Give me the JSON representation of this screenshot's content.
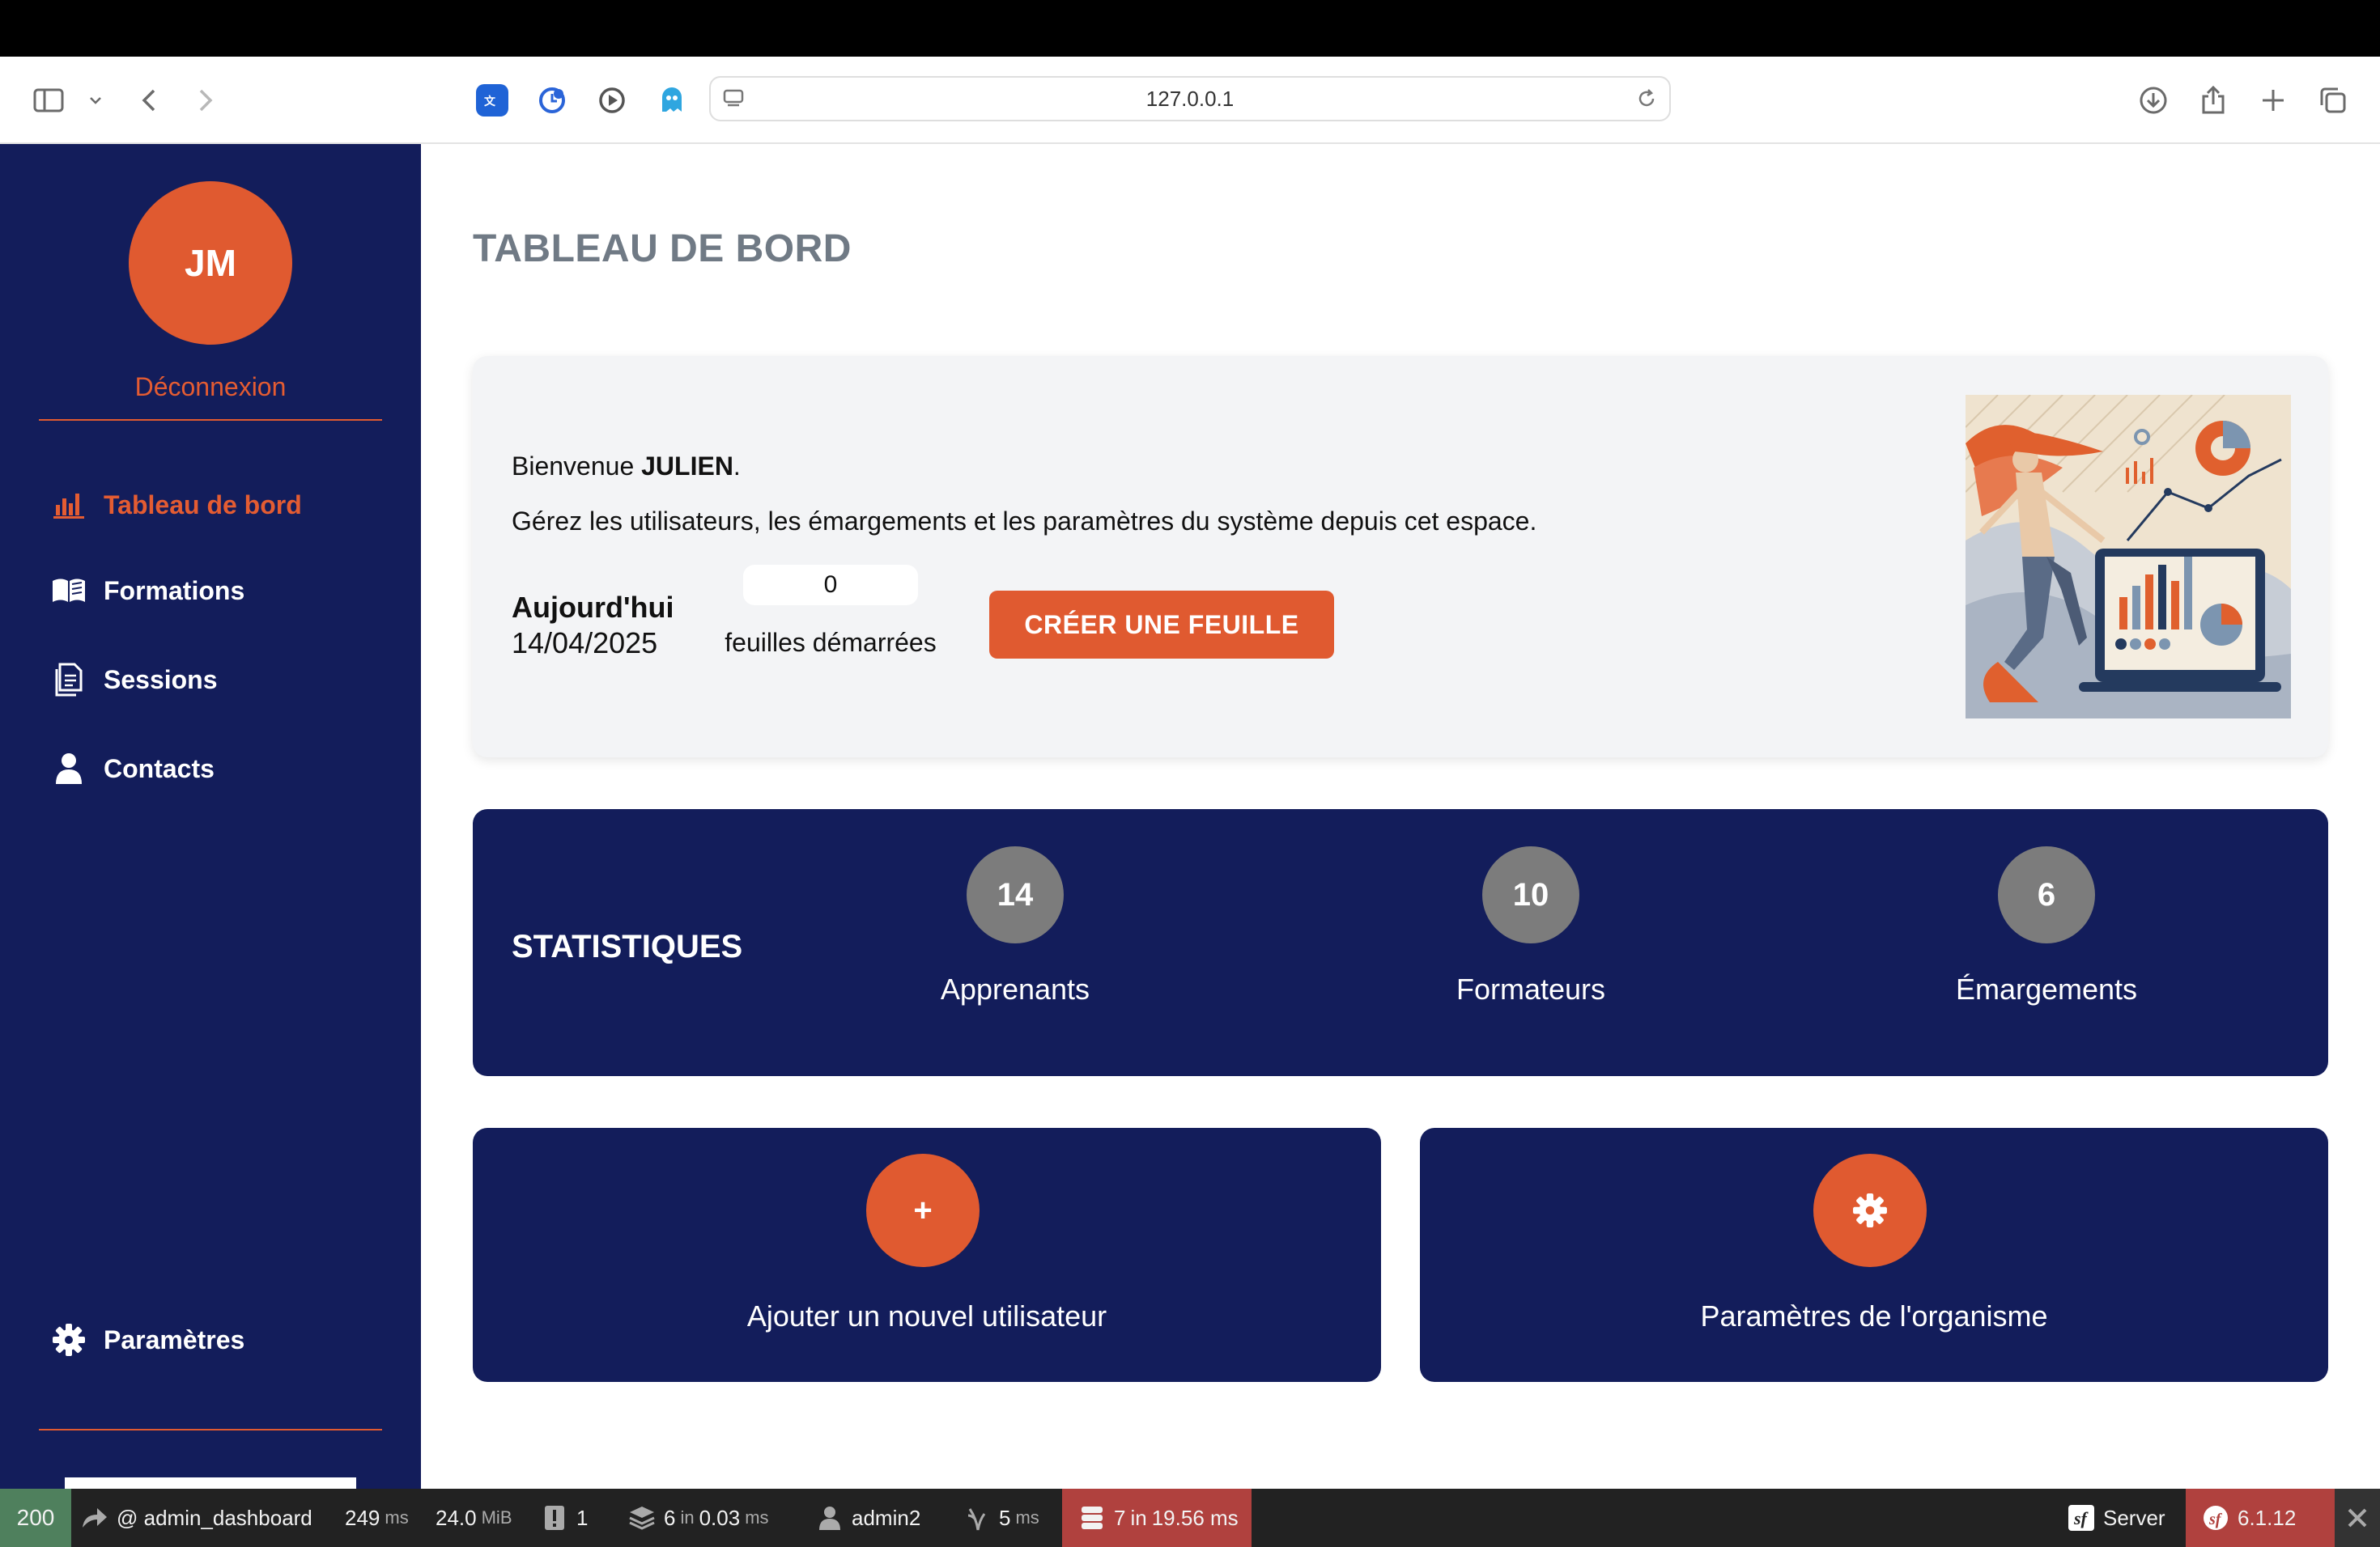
{
  "browser": {
    "url": "127.0.0.1"
  },
  "sidebar": {
    "avatar_initials": "JM",
    "logout_label": "Déconnexion",
    "items": [
      {
        "label": "Tableau de bord",
        "icon": "bar-chart-icon",
        "active": true
      },
      {
        "label": "Formations",
        "icon": "book-open-icon",
        "active": false
      },
      {
        "label": "Sessions",
        "icon": "documents-icon",
        "active": false
      },
      {
        "label": "Contacts",
        "icon": "user-icon",
        "active": false
      }
    ],
    "settings_label": "Paramètres"
  },
  "main": {
    "page_title": "TABLEAU DE BORD",
    "welcome": {
      "greeting_prefix": "Bienvenue ",
      "user_name": "JULIEN",
      "greeting_suffix": ".",
      "description": "Gérez les utilisateurs, les émargements et les paramètres du système depuis cet espace.",
      "today_label": "Aujourd'hui",
      "today_date": "14/04/2025",
      "sheets_count": "0",
      "sheets_label": "feuilles démarrées",
      "create_button": "CRÉER UNE FEUILLE"
    },
    "stats": {
      "title": "STATISTIQUES",
      "items": [
        {
          "value": "14",
          "label": "Apprenants"
        },
        {
          "value": "10",
          "label": "Formateurs"
        },
        {
          "value": "6",
          "label": "Émargements"
        }
      ]
    },
    "cards": [
      {
        "icon_glyph": "+",
        "icon": "plus-icon",
        "label": "Ajouter un nouvel utilisateur"
      },
      {
        "icon": "gear-icon",
        "label": "Paramètres de l'organisme"
      }
    ]
  },
  "debug_toolbar": {
    "status_code": "200",
    "route": "@ admin_dashboard",
    "time_value": "249",
    "time_unit": "ms",
    "memory_value": "24.0",
    "memory_unit": "MiB",
    "logs_count": "1",
    "cache_count": "6",
    "cache_in": "in",
    "cache_time": "0.03",
    "cache_unit": "ms",
    "user": "admin2",
    "twig_time": "5",
    "twig_unit": "ms",
    "db_queries": "7",
    "db_in": "in",
    "db_time": "19.56 ms",
    "server_label": "Server",
    "symfony_version": "6.1.12"
  },
  "colors": {
    "navy": "#131d5b",
    "accent": "#e05a30",
    "stat_circle": "#7c7c7c",
    "status_ok": "#4f805d"
  }
}
